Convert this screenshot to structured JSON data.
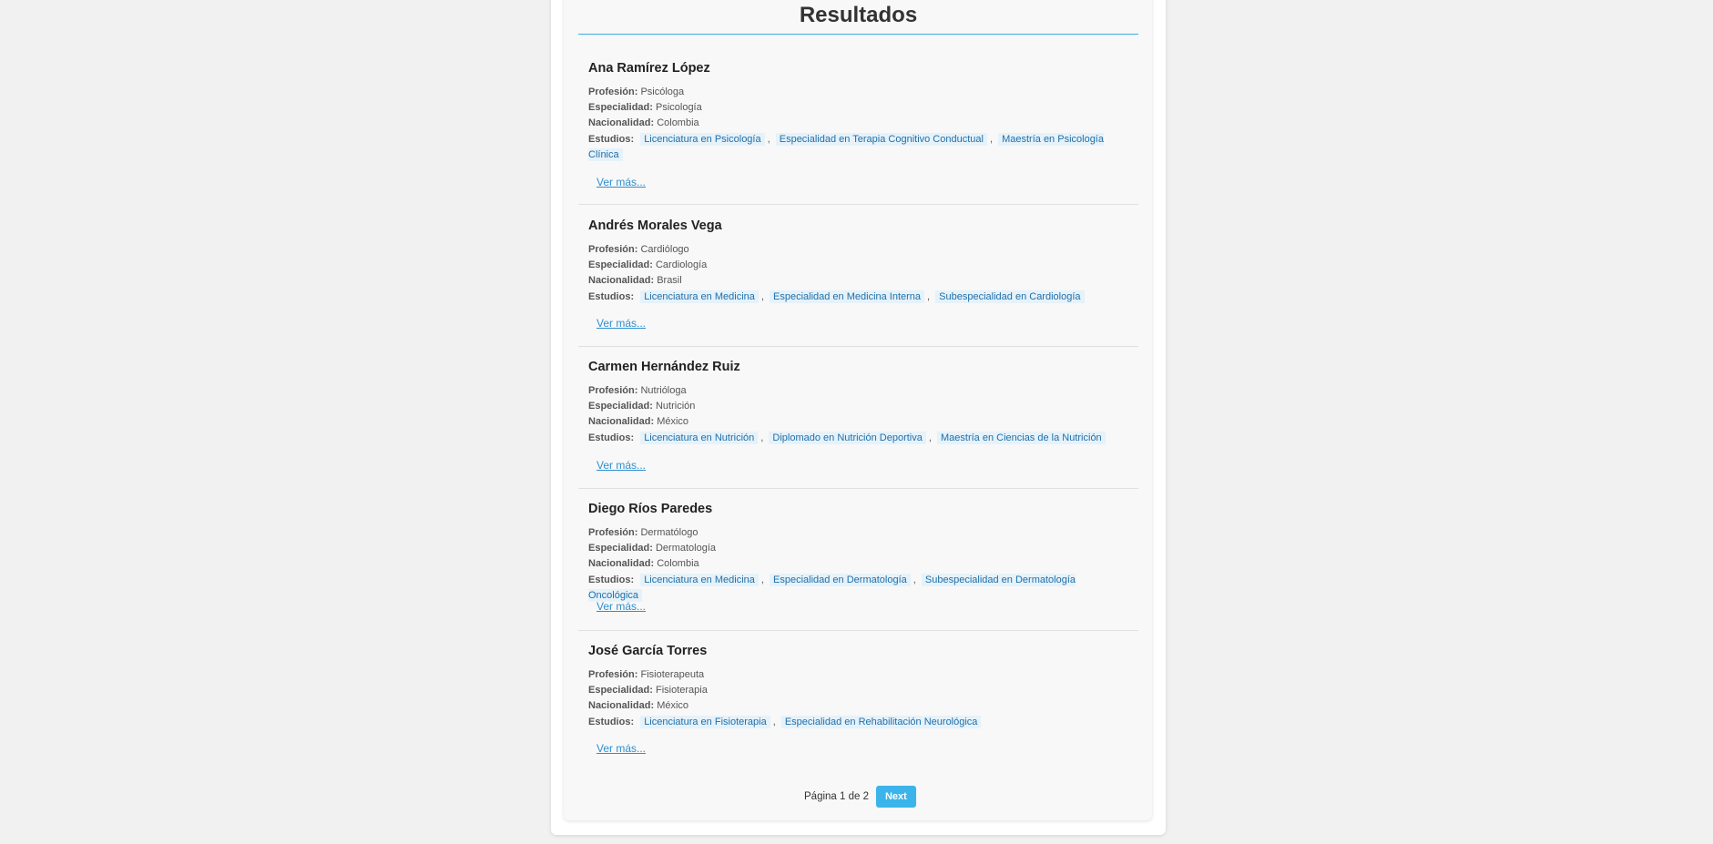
{
  "results_title": "Resultados",
  "labels": {
    "profession": "Profesión:",
    "specialty": "Especialidad:",
    "nationality": "Nacionalidad:",
    "studies": "Estudios:",
    "more": "Ver más..."
  },
  "results": [
    {
      "name": "Ana Ramírez López",
      "profession": "Psicóloga",
      "specialty": "Psicología",
      "nationality": "Colombia",
      "studies": [
        "Licenciatura en Psicología",
        "Especialidad en Terapia Cognitivo Conductual",
        "Maestría en Psicología Clínica"
      ]
    },
    {
      "name": "Andrés Morales Vega",
      "profession": "Cardiólogo",
      "specialty": "Cardiología",
      "nationality": "Brasil",
      "studies": [
        "Licenciatura en Medicina",
        "Especialidad en Medicina Interna",
        "Subespecialidad en Cardiología"
      ]
    },
    {
      "name": "Carmen Hernández Ruiz",
      "profession": "Nutrióloga",
      "specialty": "Nutrición",
      "nationality": "México",
      "studies": [
        "Licenciatura en Nutrición",
        "Diplomado en Nutrición Deportiva",
        "Maestría en Ciencias de la Nutrición"
      ]
    },
    {
      "name": "Diego Ríos Paredes",
      "profession": "Dermatólogo",
      "specialty": "Dermatología",
      "nationality": "Colombia",
      "studies": [
        "Licenciatura en Medicina",
        "Especialidad en Dermatología",
        "Subespecialidad en Dermatología Oncológica"
      ]
    },
    {
      "name": "José García Torres",
      "profession": "Fisioterapeuta",
      "specialty": "Fisioterapia",
      "nationality": "México",
      "studies": [
        "Licenciatura en Fisioterapia",
        "Especialidad en Rehabilitación Neurológica"
      ]
    }
  ],
  "pagination": {
    "info": "Página 1 de 2",
    "next_label": "Next"
  }
}
